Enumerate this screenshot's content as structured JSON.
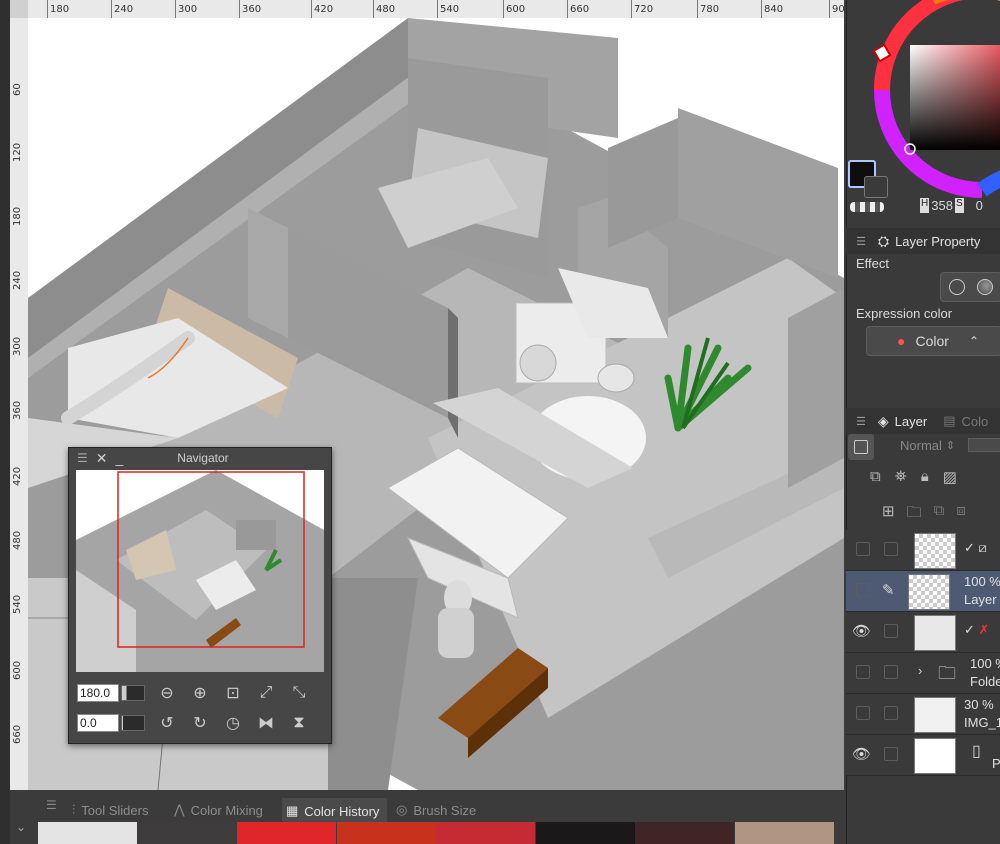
{
  "ruler": {
    "top_ticks": [
      "180",
      "240",
      "300",
      "360",
      "420",
      "480",
      "540",
      "600",
      "660",
      "720",
      "780",
      "840",
      "90"
    ],
    "left_ticks": [
      "60",
      "120",
      "180",
      "240",
      "300",
      "360",
      "420",
      "480",
      "540",
      "600",
      "660"
    ]
  },
  "navigator": {
    "title": "Navigator",
    "zoom_value": "180.0",
    "rotation_value": "0.0"
  },
  "bottom_tabs": [
    "Tool Sliders",
    "Color Mixing",
    "Color History",
    "Brush Size"
  ],
  "color_history": [
    "#e4e4e4",
    "#3d3b3c",
    "#e0262b",
    "#c8321c",
    "#c52b33",
    "#1b1819",
    "#3f2526",
    "#b09583"
  ],
  "color_wheel": {
    "h_label": "H",
    "h_value": "358",
    "s_label": "S",
    "s_value": "0",
    "main_color": "#0e0e0e",
    "sub_color": "#3a3a3a"
  },
  "layer_property": {
    "title": "Layer Property",
    "effect_label": "Effect",
    "expression_color_label": "Expression color",
    "expression_color_value": "Color"
  },
  "layer_panel": {
    "tab_layer": "Layer",
    "tab_other": "Colo",
    "blend_mode": "Normal",
    "layers": [
      {
        "opacity": "",
        "name": ""
      },
      {
        "opacity": "100 %",
        "name": "Layer"
      },
      {
        "opacity": "",
        "name": ""
      },
      {
        "opacity": "100 %",
        "name": "Folde"
      },
      {
        "opacity": "30 %",
        "name": "IMG_1"
      },
      {
        "opacity": "",
        "name": "P"
      }
    ]
  }
}
